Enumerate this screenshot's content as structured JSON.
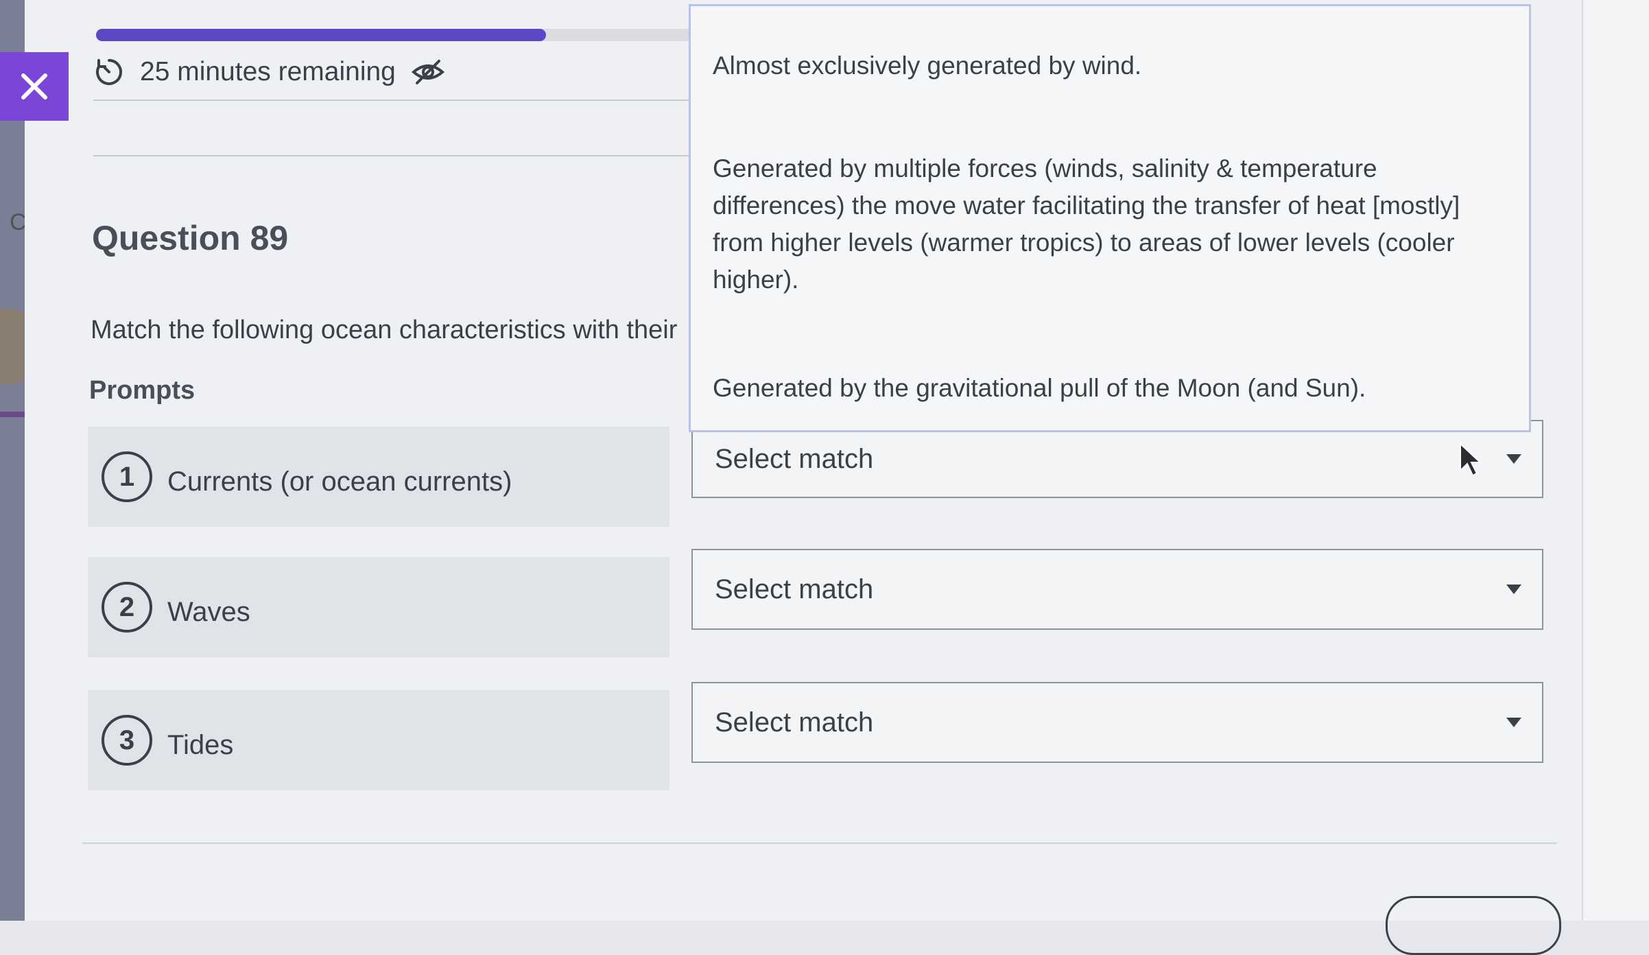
{
  "progress": {
    "fraction": 0.41,
    "color": "#5a48c4"
  },
  "timer": {
    "text": "25 minutes remaining",
    "icon": "timer-icon",
    "hide_icon": "eye-slash-icon"
  },
  "sidebar": {
    "partial_letter": "C"
  },
  "question": {
    "title": "Question 89",
    "instruction": "Match the following ocean characteristics with their",
    "prompts_heading": "Prompts"
  },
  "prompts": [
    {
      "number": "1",
      "label": "Currents (or ocean currents)"
    },
    {
      "number": "2",
      "label": "Waves"
    },
    {
      "number": "3",
      "label": "Tides"
    }
  ],
  "selects": [
    {
      "label": "Select match",
      "expanded": true
    },
    {
      "label": "Select match",
      "expanded": false
    },
    {
      "label": "Select match",
      "expanded": false
    }
  ],
  "dropdown": {
    "options": [
      "Almost exclusively generated by wind.",
      "Generated by multiple forces (winds, salinity & temperature differences) the move water facilitating the transfer of heat [mostly] from higher levels (warmer tropics) to areas of lower levels (cooler higher).",
      "Generated by the gravitational pull of the Moon (and Sun)."
    ]
  },
  "colors": {
    "accent": "#7b45d8",
    "text": "#3b3f48"
  }
}
